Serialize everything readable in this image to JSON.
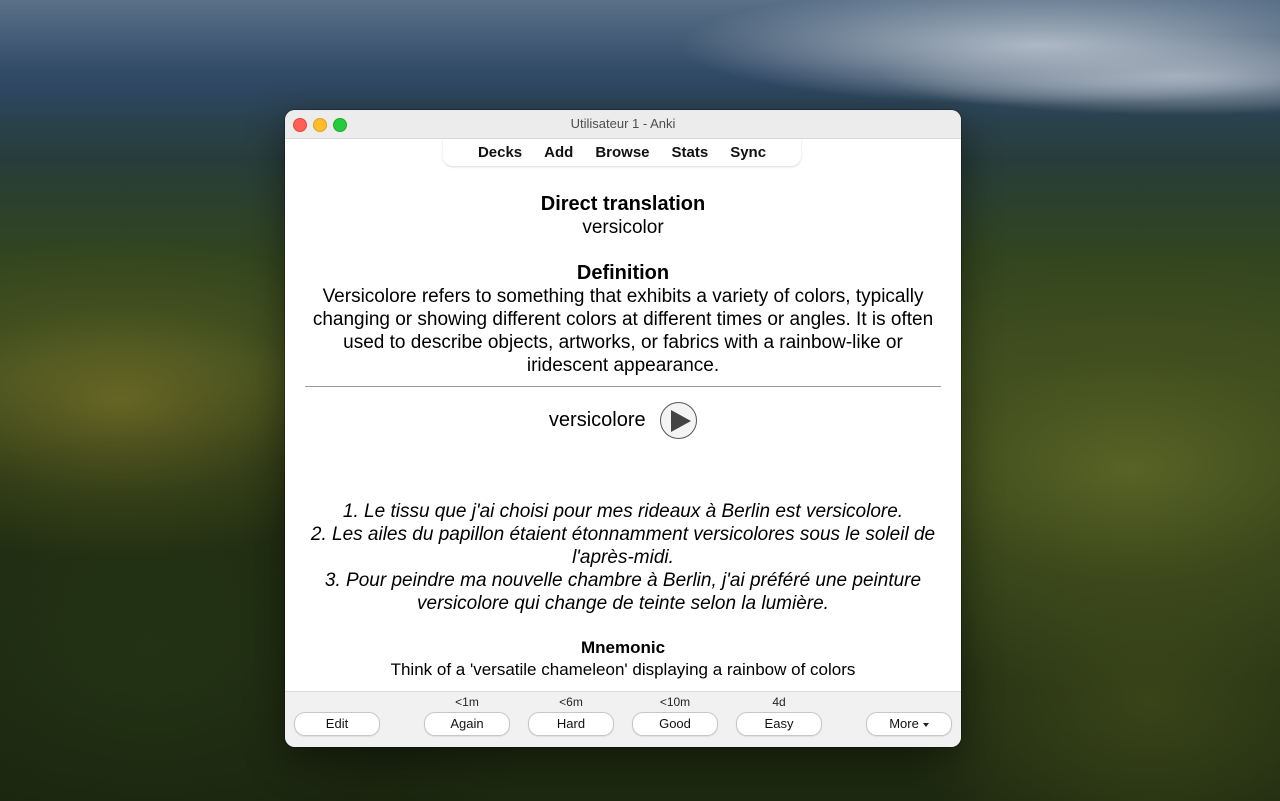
{
  "window": {
    "title": "Utilisateur 1 - Anki"
  },
  "toolbar": {
    "decks": "Decks",
    "add": "Add",
    "browse": "Browse",
    "stats": "Stats",
    "sync": "Sync"
  },
  "card": {
    "direct_translation_heading": "Direct translation",
    "direct_translation": "versicolor",
    "definition_heading": "Definition",
    "definition": "Versicolore refers to something that exhibits a variety of colors, typically changing or showing different colors at different times or angles. It is often used to describe objects, artworks, or fabrics with a rainbow-like or iridescent appearance.",
    "word": "versicolore",
    "examples": [
      "1. Le tissu que j'ai choisi pour mes rideaux à Berlin est versicolore.",
      "2. Les ailes du papillon étaient étonnamment versicolores sous le soleil de l'après-midi.",
      "3. Pour peindre ma nouvelle chambre à Berlin, j'ai préféré une peinture versicolore qui change de teinte selon la lumière."
    ],
    "mnemonic_heading": "Mnemonic",
    "mnemonic": "Think of a 'versatile chameleon' displaying a rainbow of colors"
  },
  "bottom_bar": {
    "edit": "Edit",
    "again": {
      "label": "Again",
      "interval": "<1m"
    },
    "hard": {
      "label": "Hard",
      "interval": "<6m"
    },
    "good": {
      "label": "Good",
      "interval": "<10m"
    },
    "easy": {
      "label": "Easy",
      "interval": "4d"
    },
    "more": "More"
  },
  "icons": {
    "play": "play-icon",
    "more_caret": "chevron-down-icon"
  }
}
